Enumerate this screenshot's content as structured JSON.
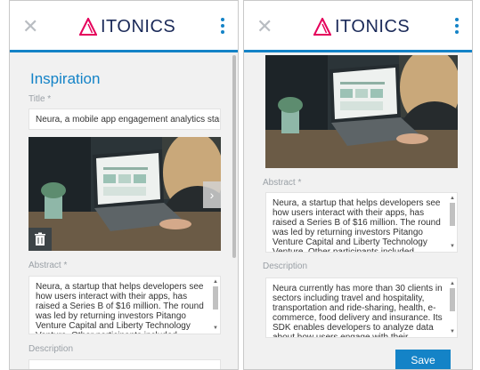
{
  "app": {
    "brand": "ITONICS"
  },
  "colors": {
    "accent": "#1483c7",
    "brand_text": "#1b2a59",
    "background": "#f1f1f1"
  },
  "icons": {
    "close": "close-icon",
    "menu": "more-vertical-icon",
    "delete": "trash-icon",
    "next": "chevron-right-icon"
  },
  "form": {
    "heading": "Inspiration",
    "title_label": "Title *",
    "title_value": "Neura, a mobile app engagement analytics startup",
    "abstract_label": "Abstract *",
    "abstract_text": "Neura, a startup that helps developers see how users interact with their apps, has raised a Series B of $16 million. The round was led by returning investors Pitango Venture Capital and Liberty Technology Venture. Other participants included",
    "description_label": "Description",
    "description_text": "Neura  currently has more than 30 clients in sectors including travel and hospitality, transportation and ride-sharing, health, e-commerce, food delivery and insurance. Its SDK enables developers to analyze data about how users engage with their",
    "save_label": "Save"
  }
}
